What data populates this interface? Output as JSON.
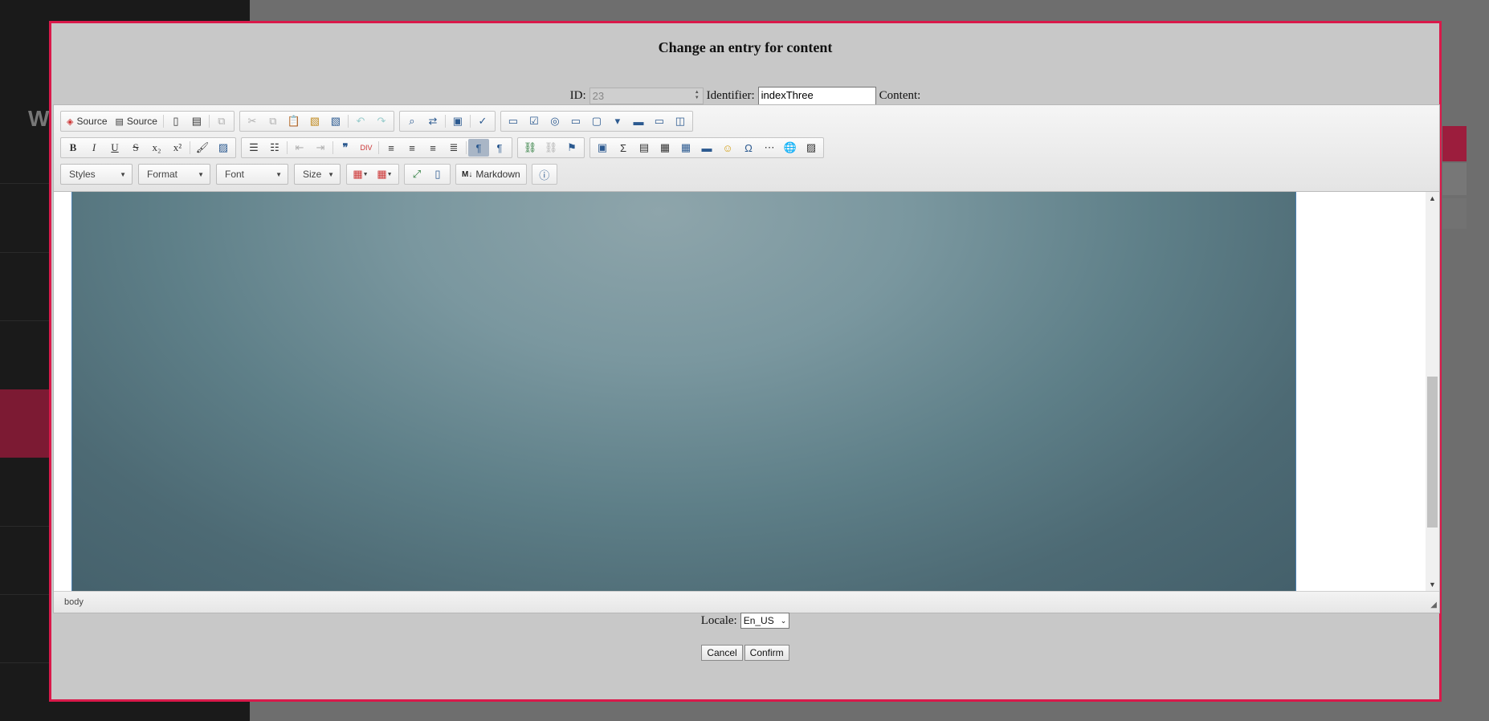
{
  "background": {
    "sidebar_letter": "W"
  },
  "modal": {
    "title": "Change an entry for content",
    "id_label": "ID:",
    "id_value": "23",
    "identifier_label": "Identifier:",
    "identifier_value": "indexThree",
    "content_label": "Content:",
    "locale_label": "Locale:",
    "locale_value": "En_US",
    "cancel_label": "Cancel",
    "confirm_label": "Confirm"
  },
  "editor": {
    "source_label_1": "Source",
    "source_label_2": "Source",
    "combos": {
      "styles": "Styles",
      "format": "Format",
      "font": "Font",
      "size": "Size"
    },
    "markdown_label": "Markdown",
    "path": "body"
  },
  "colors": {
    "accent": "#d9194a",
    "bg": "#6e6e6e",
    "modal_bg": "#c8c8c8"
  }
}
